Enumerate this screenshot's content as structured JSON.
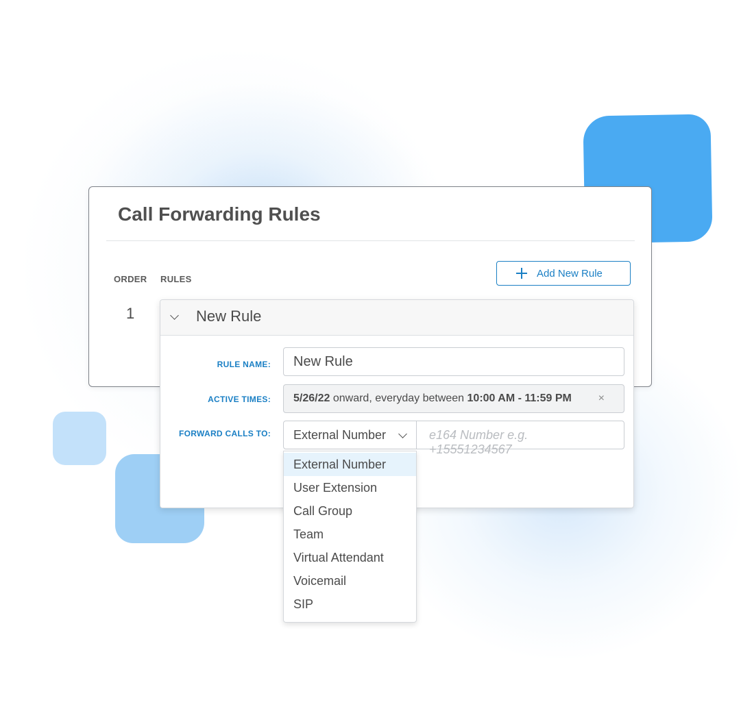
{
  "card": {
    "title": "Call Forwarding Rules",
    "columns": {
      "order": "ORDER",
      "rules": "RULES"
    },
    "add_button_label": "Add New Rule",
    "order_number": "1"
  },
  "rule": {
    "header_title": "New Rule",
    "labels": {
      "rule_name": "RULE NAME:",
      "active_times": "ACTIVE TIMES:",
      "forward_calls_to": "FORWARD CALLS TO:"
    },
    "rule_name_value": "New Rule",
    "active_times": {
      "date": "5/26/22",
      "middle": " onward, everyday between ",
      "range": "10:00 AM - 11:59 PM",
      "clear": "×"
    },
    "forward_type_value": "External Number",
    "number_placeholder": "e164 Number e.g. +15551234567"
  },
  "dropdown": {
    "options": [
      "External Number",
      "User Extension",
      "Call Group",
      "Team",
      "Virtual Attendant",
      "Voicemail",
      "SIP"
    ],
    "selected": "External Number"
  },
  "colors": {
    "accent": "#1a7fc4",
    "blob_dark": "#4aaaf2",
    "blob_mid": "#9ecff5",
    "blob_light": "#c3e1fa"
  },
  "icons": [
    "plus-icon",
    "chevron-down-icon",
    "close-icon"
  ]
}
